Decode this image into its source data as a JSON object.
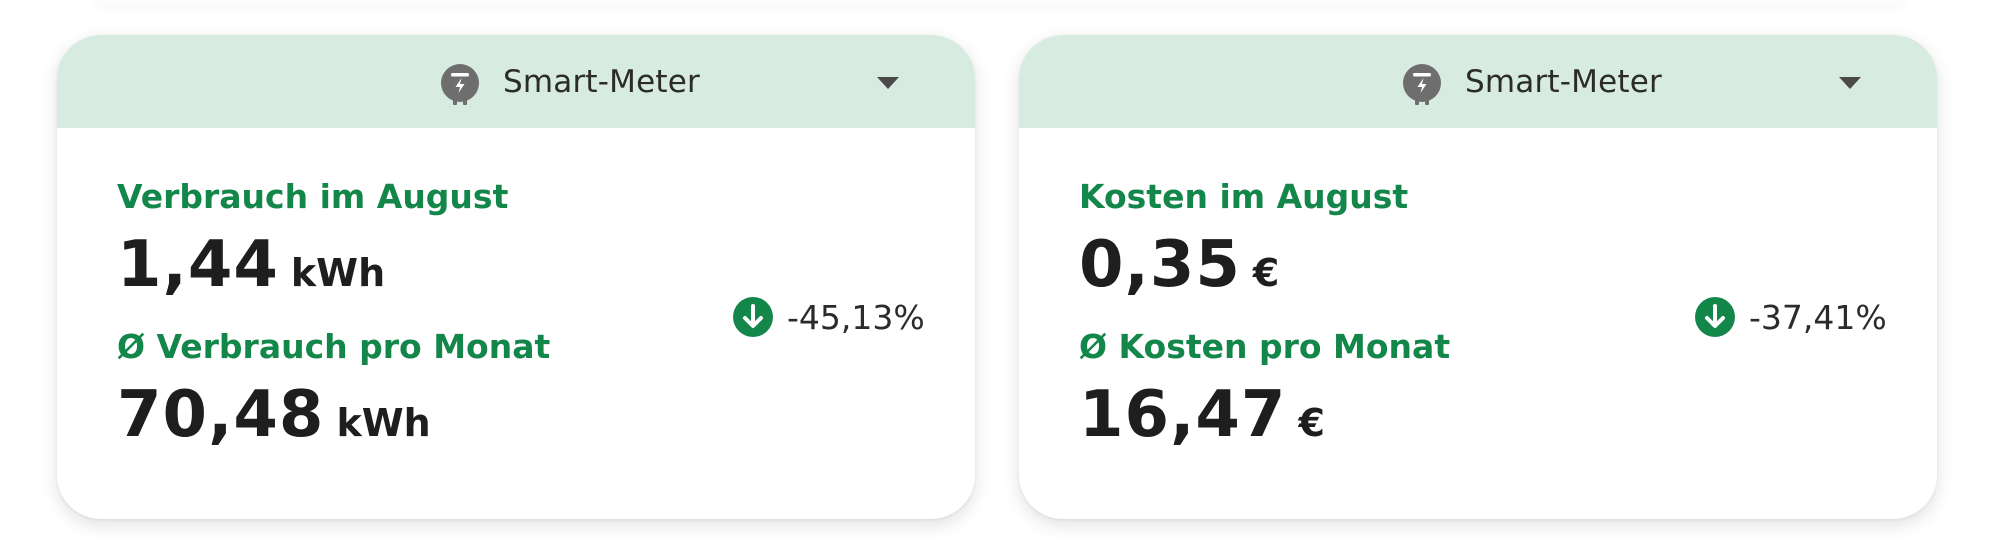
{
  "colors": {
    "accent": "#13864a",
    "header_bg": "#d7ebe0",
    "text": "#1e1e1e"
  },
  "cards": [
    {
      "header": {
        "icon": "smart-meter-icon",
        "label": "Smart-Meter",
        "dropdown_icon": "chevron-down-icon"
      },
      "primary": {
        "label": "Verbrauch im August",
        "value": "1,44",
        "unit": "kWh"
      },
      "secondary": {
        "label": "Ø Verbrauch pro Monat",
        "value": "70,48",
        "unit": "kWh"
      },
      "trend": {
        "icon": "arrow-down-circle-icon",
        "text": "-45,13%"
      }
    },
    {
      "header": {
        "icon": "smart-meter-icon",
        "label": "Smart-Meter",
        "dropdown_icon": "chevron-down-icon"
      },
      "primary": {
        "label": "Kosten im August",
        "value": "0,35",
        "unit": "€"
      },
      "secondary": {
        "label": "Ø Kosten pro Monat",
        "value": "16,47",
        "unit": "€"
      },
      "trend": {
        "icon": "arrow-down-circle-icon",
        "text": "-37,41%"
      }
    }
  ]
}
